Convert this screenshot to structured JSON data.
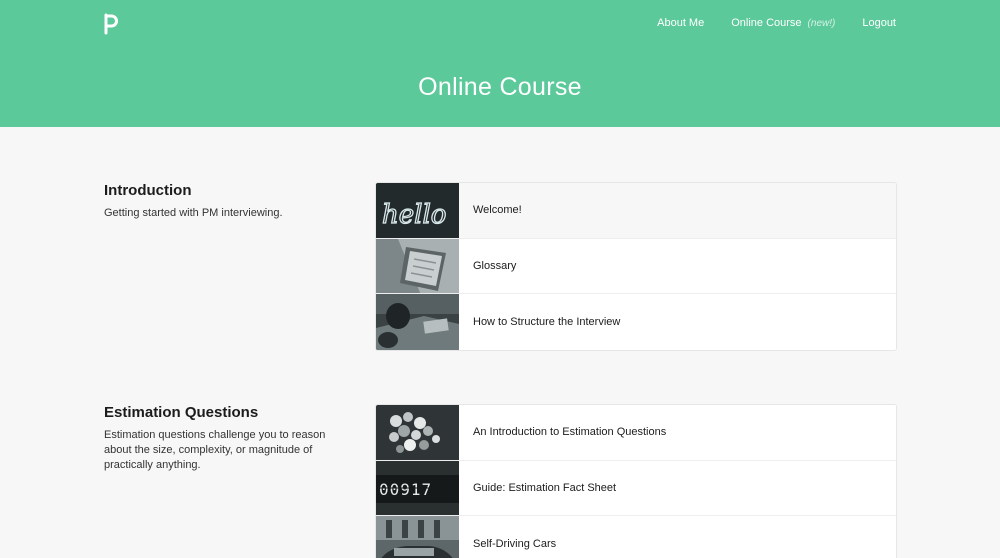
{
  "header": {
    "logo_letter": "p",
    "nav": {
      "about": "About Me",
      "course": "Online Course",
      "course_badge": "(new!)",
      "logout": "Logout"
    },
    "title": "Online Course"
  },
  "sections": [
    {
      "title": "Introduction",
      "description": "Getting started with PM interviewing.",
      "lessons": [
        {
          "label": "Welcome!",
          "thumb_text": "hello"
        },
        {
          "label": "Glossary"
        },
        {
          "label": "How to Structure the Interview"
        }
      ]
    },
    {
      "title": "Estimation Questions",
      "description": "Estimation questions challenge you to reason about the size, complexity, or magnitude of practically anything.",
      "lessons": [
        {
          "label": "An Introduction to Estimation Questions"
        },
        {
          "label": "Guide: Estimation Fact Sheet",
          "thumb_text": "00917"
        },
        {
          "label": "Self-Driving Cars"
        }
      ]
    }
  ],
  "colors": {
    "header_bg": "#5cc99b",
    "page_bg": "#f7f7f7"
  }
}
